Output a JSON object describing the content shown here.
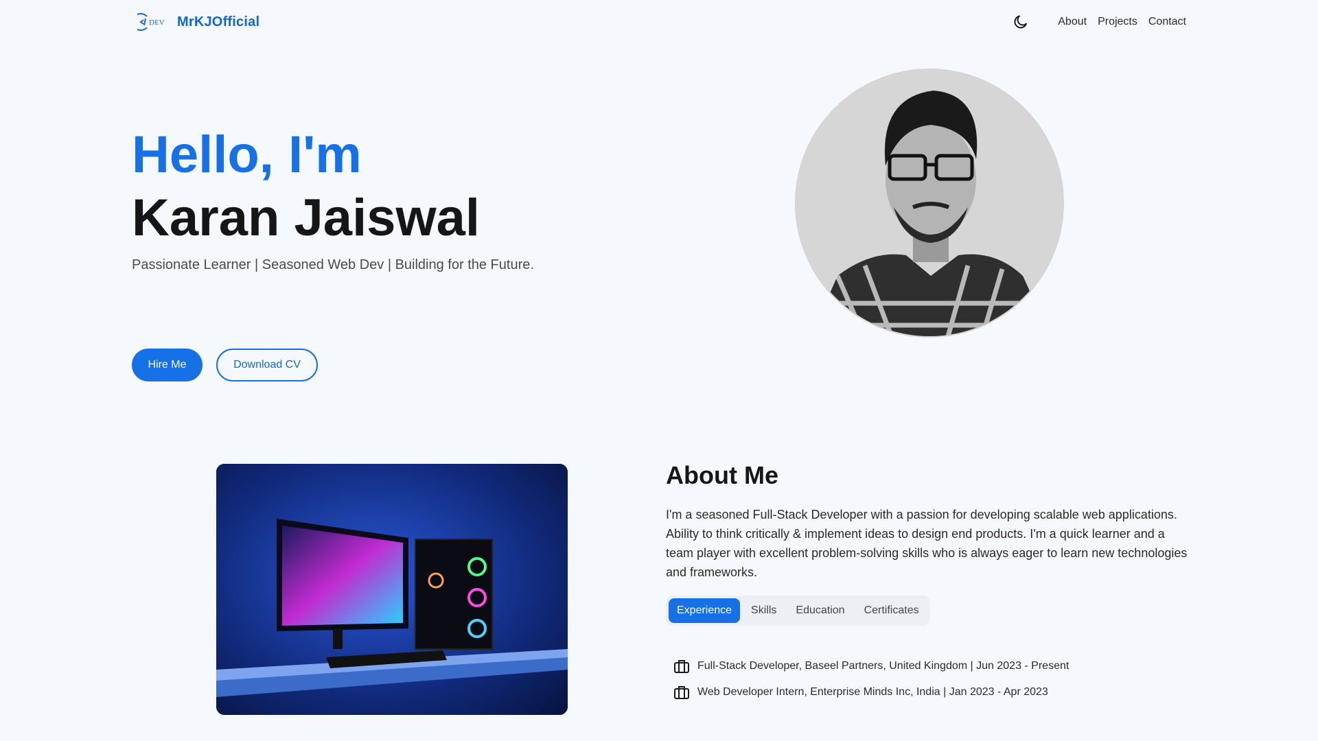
{
  "header": {
    "logo_badge": "DEV",
    "brand": "MrKJOfficial",
    "theme_icon": "moon-icon",
    "nav": [
      {
        "label": "About"
      },
      {
        "label": "Projects"
      },
      {
        "label": "Contact"
      }
    ]
  },
  "hero": {
    "greeting": "Hello, I'm",
    "name": "Karan Jaiswal",
    "tagline": "Passionate Learner | Seasoned Web Dev | Building for the Future.",
    "primary_button": "Hire Me",
    "secondary_button": "Download CV"
  },
  "about": {
    "title": "About Me",
    "description": "I'm a seasoned Full-Stack Developer with a passion for developing scalable web applications. Ability to think critically & implement ideas to design end products. I'm a quick learner and a team player with excellent problem-solving skills who is always eager to learn new technologies and frameworks.",
    "tabs": [
      {
        "label": "Experience",
        "active": true
      },
      {
        "label": "Skills",
        "active": false
      },
      {
        "label": "Education",
        "active": false
      },
      {
        "label": "Certificates",
        "active": false
      }
    ],
    "experience": [
      {
        "icon": "briefcase-icon",
        "text": "Full-Stack Developer, Baseel Partners, United Kingdom | Jun 2023 - Present"
      },
      {
        "icon": "briefcase-icon",
        "text": "Web Developer Intern, Enterprise Minds Inc, India | Jan 2023 - Apr 2023"
      }
    ]
  },
  "colors": {
    "accent": "#1670e6",
    "background": "#f5f8fc",
    "text_dark": "#161616"
  }
}
